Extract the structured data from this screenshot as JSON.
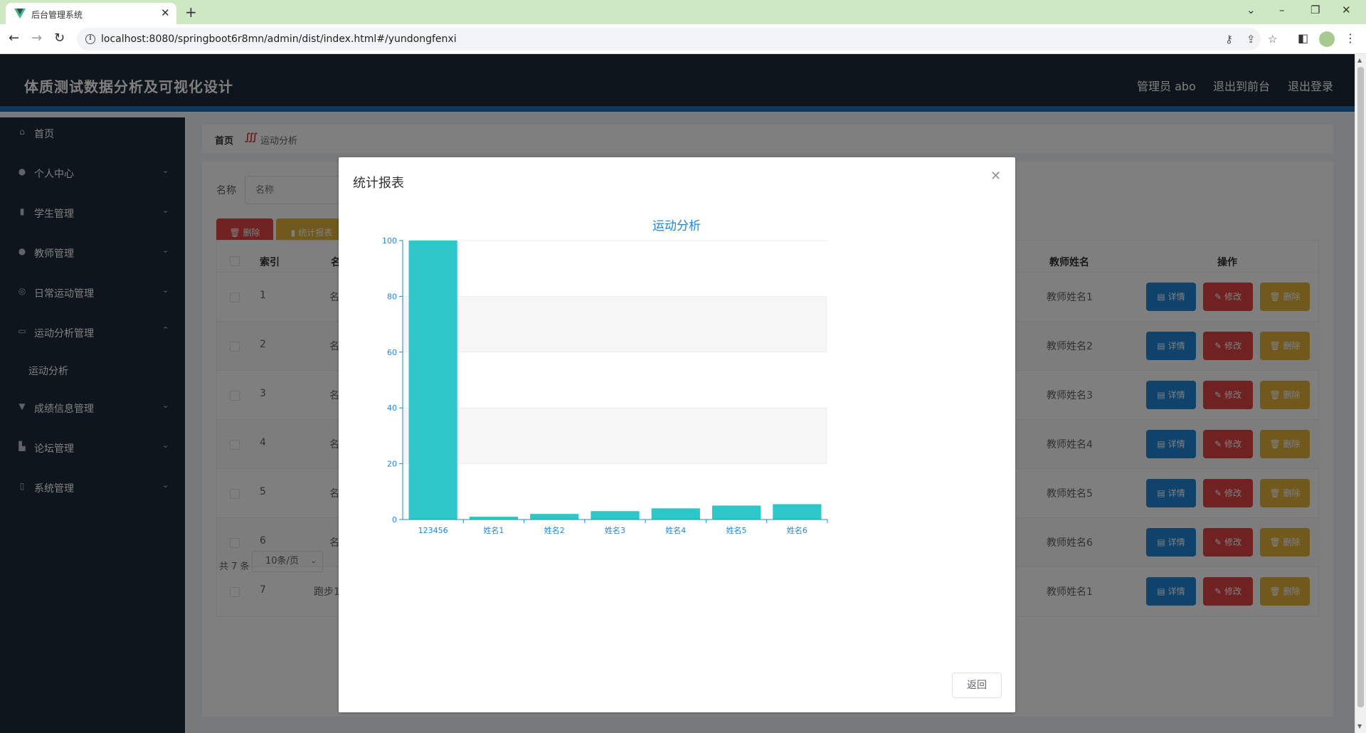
{
  "browser": {
    "tab_title": "后台管理系统",
    "url": "localhost:8080/springboot6r8mn/admin/dist/index.html#/yundongfenxi"
  },
  "header": {
    "title": "体质测试数据分析及可视化设计",
    "user": "管理员 abo",
    "to_front": "退出到前台",
    "logout": "退出登录"
  },
  "sidebar": {
    "items": [
      {
        "label": "首页",
        "icon": "home-icon"
      },
      {
        "label": "个人中心",
        "icon": "user-icon"
      },
      {
        "label": "学生管理",
        "icon": "bar-chart-icon"
      },
      {
        "label": "教师管理",
        "icon": "location-icon"
      },
      {
        "label": "日常运动管理",
        "icon": "compass-icon"
      },
      {
        "label": "运动分析管理",
        "icon": "picture-icon",
        "expanded": true
      },
      {
        "label": "成绩信息管理",
        "icon": "medal-icon"
      },
      {
        "label": "论坛管理",
        "icon": "thumb-icon"
      },
      {
        "label": "系统管理",
        "icon": "phone-icon"
      }
    ],
    "subitem": "运动分析"
  },
  "breadcrumb": {
    "home": "首页",
    "current": "运动分析"
  },
  "search": {
    "label": "名称",
    "placeholder": "名称"
  },
  "actions": {
    "delete": "删除",
    "report": "统计报表"
  },
  "table": {
    "headers": {
      "index": "索引",
      "name": "名",
      "teacher": "教师姓名",
      "ops": "操作"
    },
    "rows": [
      {
        "index": "1",
        "name": "名",
        "teacher": "教师姓名1"
      },
      {
        "index": "2",
        "name": "名",
        "teacher": "教师姓名2"
      },
      {
        "index": "3",
        "name": "名",
        "teacher": "教师姓名3"
      },
      {
        "index": "4",
        "name": "名",
        "teacher": "教师姓名4"
      },
      {
        "index": "5",
        "name": "名",
        "teacher": "教师姓名5"
      },
      {
        "index": "6",
        "name": "名",
        "teacher": "教师姓名6"
      },
      {
        "index": "7",
        "name": "跑步1",
        "teacher": "教师姓名1"
      }
    ],
    "row_actions": {
      "detail": "详情",
      "edit": "修改",
      "delete": "删除"
    }
  },
  "pager": {
    "total": "共 7 条",
    "size": "10条/页"
  },
  "dialog": {
    "title": "统计报表",
    "back": "返回"
  },
  "colors": {
    "header_bg": "#1e2a38",
    "accent_blue": "#1e87d8",
    "danger": "#e04444",
    "warning": "#e2b23a",
    "bar": "#2ec7c9",
    "chart_text": "#1e87d8"
  },
  "chart_data": {
    "type": "bar",
    "title": "运动分析",
    "categories": [
      "123456",
      "姓名1",
      "姓名2",
      "姓名3",
      "姓名4",
      "姓名5",
      "姓名6"
    ],
    "values": [
      100,
      1,
      2,
      3,
      4,
      5,
      5.5
    ],
    "ylim": [
      0,
      100
    ],
    "yticks": [
      0,
      20,
      40,
      60,
      80,
      100
    ],
    "grid": true,
    "striped_bands": true
  }
}
